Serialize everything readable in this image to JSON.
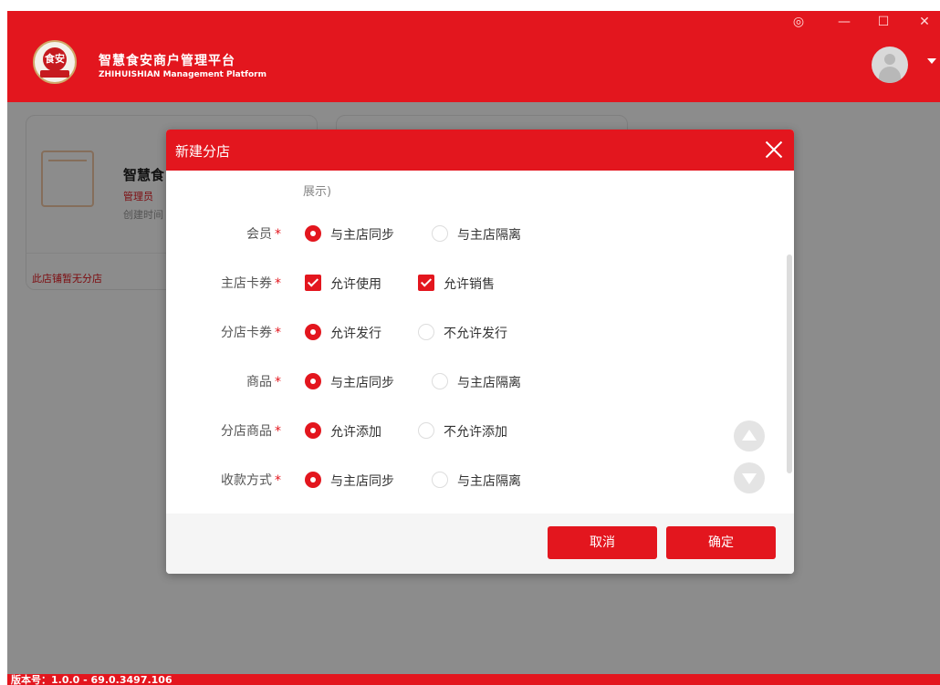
{
  "header": {
    "brand_cn": "智慧食安商户管理平台",
    "brand_en": "ZHIHUISHIAN Management Platform",
    "logo_text": "食安",
    "controls": {
      "settings": "◎",
      "minimize": "—",
      "maximize": "☐",
      "close": "✕"
    }
  },
  "background": {
    "card_title": "智慧食",
    "card_role": "管理员",
    "card_time": "创建时间",
    "card_footer": "此店铺暂无分店"
  },
  "modal": {
    "title": "新建分店",
    "hint": "展示)",
    "rows": [
      {
        "label": "会员",
        "options": [
          {
            "text": "与主店同步",
            "type": "radio",
            "checked": true
          },
          {
            "text": "与主店隔离",
            "type": "radio",
            "checked": false
          }
        ]
      },
      {
        "label": "主店卡券",
        "options": [
          {
            "text": "允许使用",
            "type": "checkbox",
            "checked": true
          },
          {
            "text": "允许销售",
            "type": "checkbox",
            "checked": true
          }
        ]
      },
      {
        "label": "分店卡券",
        "options": [
          {
            "text": "允许发行",
            "type": "radio",
            "checked": true
          },
          {
            "text": "不允许发行",
            "type": "radio",
            "checked": false
          }
        ]
      },
      {
        "label": "商品",
        "options": [
          {
            "text": "与主店同步",
            "type": "radio",
            "checked": true
          },
          {
            "text": "与主店隔离",
            "type": "radio",
            "checked": false
          }
        ]
      },
      {
        "label": "分店商品",
        "options": [
          {
            "text": "允许添加",
            "type": "radio",
            "checked": true
          },
          {
            "text": "不允许添加",
            "type": "radio",
            "checked": false
          }
        ]
      },
      {
        "label": "收款方式",
        "options": [
          {
            "text": "与主店同步",
            "type": "radio",
            "checked": true
          },
          {
            "text": "与主店隔离",
            "type": "radio",
            "checked": false
          }
        ]
      }
    ],
    "required_mark": "*",
    "cancel_label": "取消",
    "confirm_label": "确定"
  },
  "footer": {
    "version": "版本号：1.0.0 - 69.0.3497.106"
  },
  "colors": {
    "primary": "#e3161e",
    "overlay": "rgba(0,0,0,0.45)"
  }
}
